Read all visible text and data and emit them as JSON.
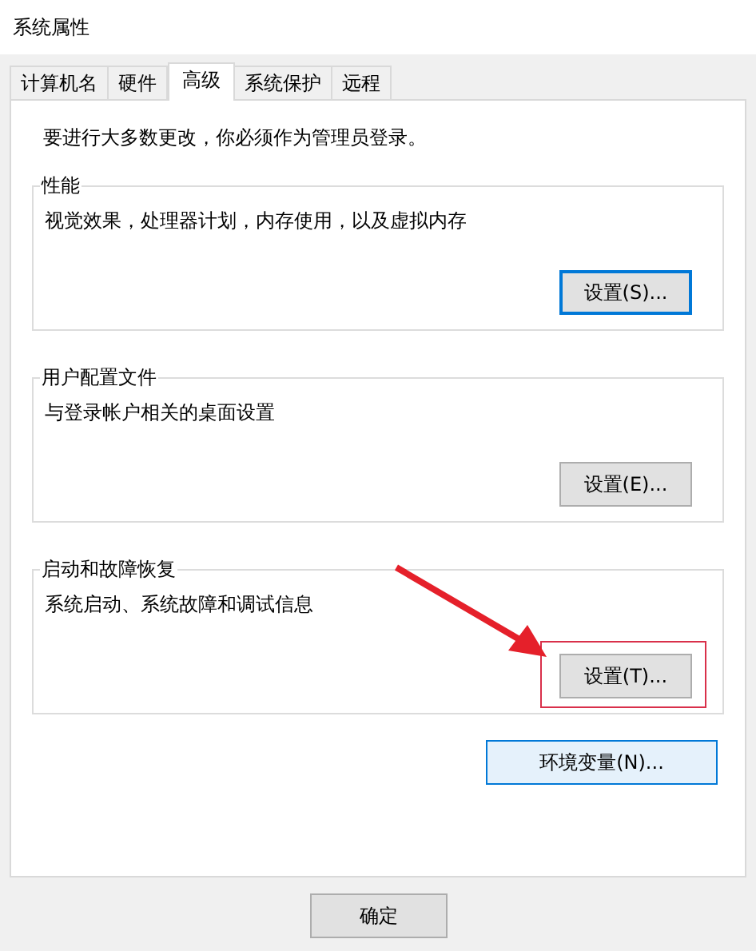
{
  "window": {
    "title": "系统属性"
  },
  "tabs": [
    {
      "label": "计算机名",
      "selected": false
    },
    {
      "label": "硬件",
      "selected": false
    },
    {
      "label": "高级",
      "selected": true
    },
    {
      "label": "系统保护",
      "selected": false
    },
    {
      "label": "远程",
      "selected": false
    }
  ],
  "notice": "要进行大多数更改，你必须作为管理员登录。",
  "groups": [
    {
      "title": "性能",
      "description": "视觉效果，处理器计划，内存使用，以及虚拟内存",
      "button": {
        "label": "设置(S)...",
        "focused": true,
        "hovered": false
      },
      "highlighted": false
    },
    {
      "title": "用户配置文件",
      "description": "与登录帐户相关的桌面设置",
      "button": {
        "label": "设置(E)...",
        "focused": false,
        "hovered": false
      },
      "highlighted": false
    },
    {
      "title": "启动和故障恢复",
      "description": "系统启动、系统故障和调试信息",
      "button": {
        "label": "设置(T)...",
        "focused": false,
        "hovered": false
      },
      "highlighted": true
    }
  ],
  "env_button": {
    "label": "环境变量(N)...",
    "focused": false,
    "hovered": true
  },
  "footer_buttons": [
    {
      "label": "确定",
      "focused": false,
      "hovered": false
    }
  ]
}
